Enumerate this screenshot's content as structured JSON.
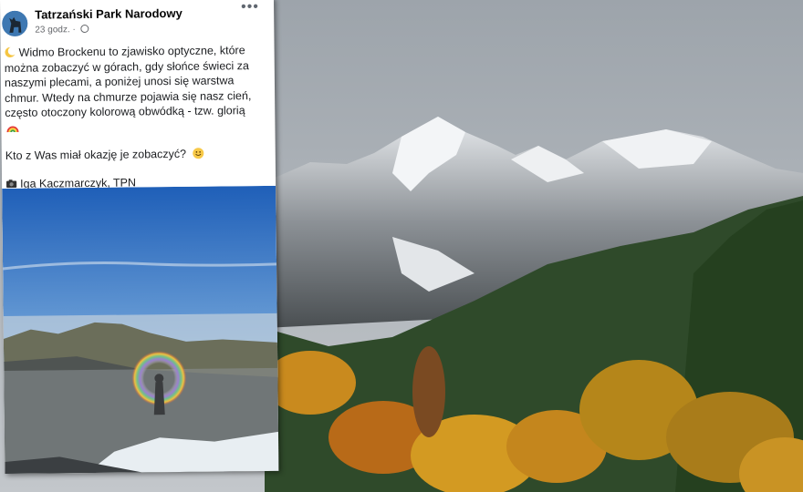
{
  "post": {
    "page_name": "Tatrzański Park Narodowy",
    "time": "23 godz.",
    "menu_icon": "more-dots-icon",
    "paragraph1": "Widmo Brockenu to zjawisko optyczne, które można zobaczyć w górach, gdy słońce świeci za naszymi plecami, a poniżej unosi się warstwa chmur. Wtedy na chmurze pojawia się nasz cień, często otoczony kolorową obwódką - tzw. glorią",
    "paragraph2": "Kto z Was miał okazję je zobaczyć?",
    "credit": "Iga Kaczmarczyk, TPN",
    "icons": [
      "moon-icon",
      "rainbow-icon",
      "smile-icon",
      "camera-icon",
      "globe-icon"
    ]
  },
  "colors": {
    "sky": "#a9b0b6",
    "forest": "#2f4a2a",
    "autumn": "#c98a1e",
    "post_sky": "#2f6fc2"
  }
}
